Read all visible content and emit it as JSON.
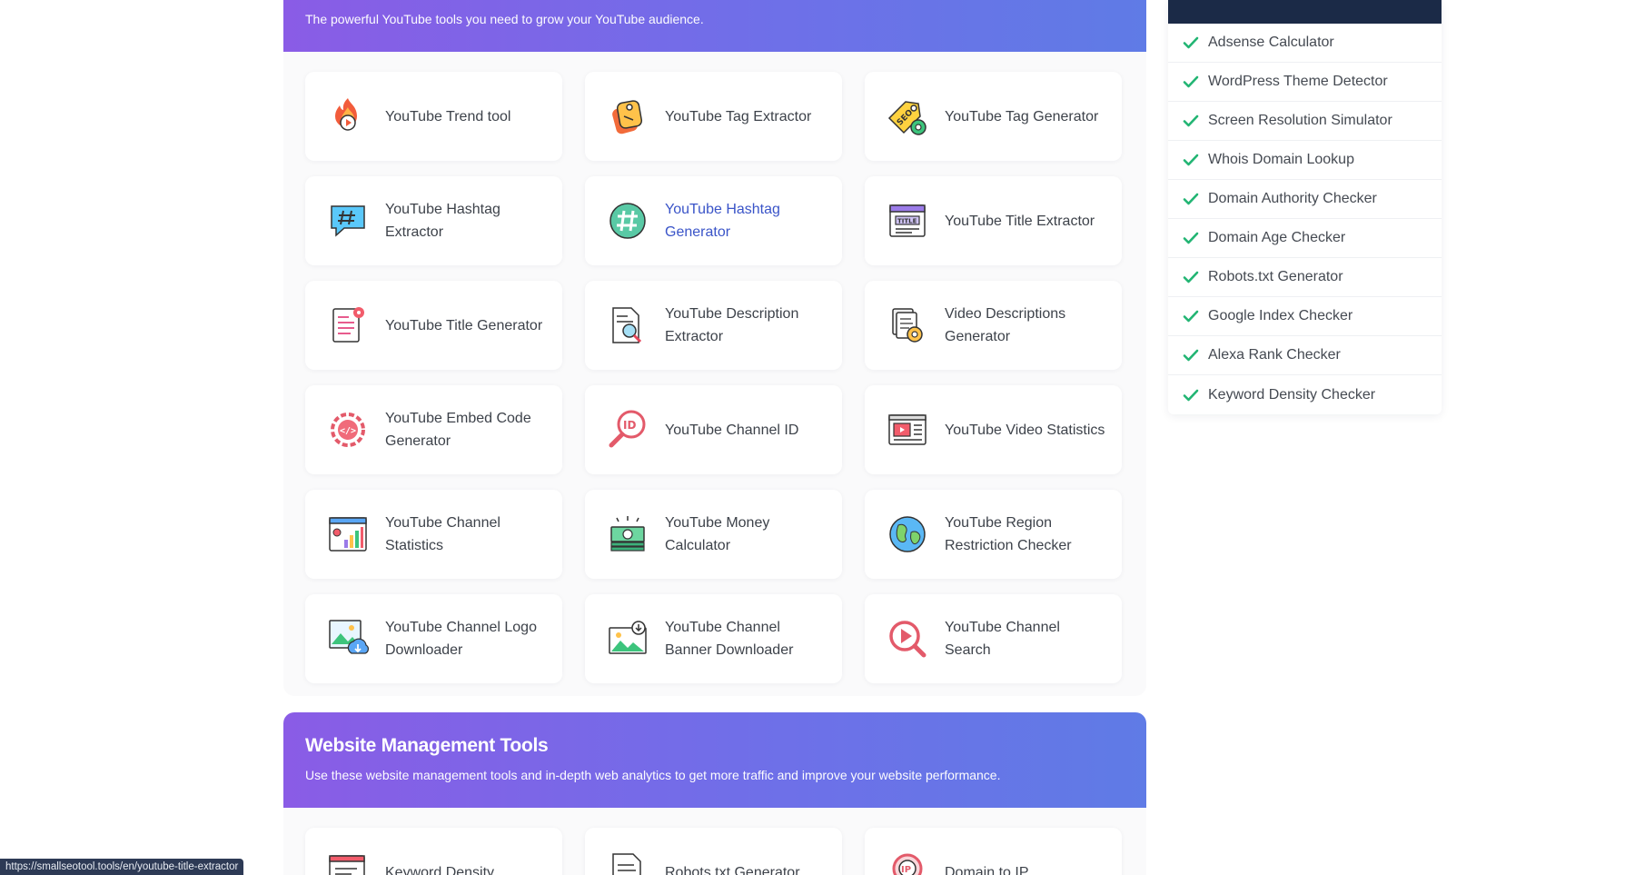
{
  "youtube_section": {
    "subtitle": "The powerful YouTube tools you need to grow your YouTube audience.",
    "tools": [
      {
        "label": "YouTube Trend tool",
        "icon": "flame-play-icon"
      },
      {
        "label": "YouTube Tag Extractor",
        "icon": "tag-extractor-icon"
      },
      {
        "label": "YouTube Tag Generator",
        "icon": "seo-tag-gear-icon"
      },
      {
        "label": "YouTube Hashtag Extractor",
        "icon": "hashtag-bubble-icon"
      },
      {
        "label": "YouTube Hashtag Generator",
        "icon": "hashtag-circle-icon"
      },
      {
        "label": "YouTube Title Extractor",
        "icon": "title-window-icon"
      },
      {
        "label": "YouTube Title Generator",
        "icon": "document-gear-icon"
      },
      {
        "label": "YouTube Description Extractor",
        "icon": "document-search-icon"
      },
      {
        "label": "Video Descriptions Generator",
        "icon": "documents-gear-icon"
      },
      {
        "label": "YouTube Embed Code Generator",
        "icon": "code-gear-icon"
      },
      {
        "label": "YouTube Channel ID",
        "icon": "id-magnifier-icon"
      },
      {
        "label": "YouTube Video Statistics",
        "icon": "video-stats-icon"
      },
      {
        "label": "YouTube Channel Statistics",
        "icon": "channel-bar-chart-icon"
      },
      {
        "label": "YouTube Money Calculator",
        "icon": "money-stack-icon"
      },
      {
        "label": "YouTube Region Restriction Checker",
        "icon": "globe-icon"
      },
      {
        "label": "YouTube Channel Logo Downloader",
        "icon": "image-cloud-download-icon"
      },
      {
        "label": "YouTube Channel Banner Downloader",
        "icon": "banner-download-icon"
      },
      {
        "label": "YouTube Channel Search",
        "icon": "play-search-icon"
      }
    ]
  },
  "website_section": {
    "title": "Website Management Tools",
    "subtitle": "Use these website management tools and in-depth web analytics to get more traffic and improve your website performance.",
    "tools": [
      {
        "label": "Keyword Density",
        "icon": "keyword-window-icon"
      },
      {
        "label": "Robots.txt Generator",
        "icon": "robots-document-icon"
      },
      {
        "label": "Domain to IP",
        "icon": "ip-pin-icon"
      }
    ]
  },
  "sidebar": {
    "items": [
      "Adsense Calculator",
      "WordPress Theme Detector",
      "Screen Resolution Simulator",
      "Whois Domain Lookup",
      "Domain Authority Checker",
      "Domain Age Checker",
      "Robots.txt Generator",
      "Google Index Checker",
      "Alexa Rank Checker",
      "Keyword Density Checker"
    ]
  },
  "status_url": "https://smallseotool.tools/en/youtube-title-extractor",
  "colors": {
    "banner_start": "#8a5ce6",
    "banner_end": "#5f7be6",
    "sidebar_header": "#1b2a47",
    "check_green": "#22b573",
    "active_link": "#3a54c8"
  }
}
